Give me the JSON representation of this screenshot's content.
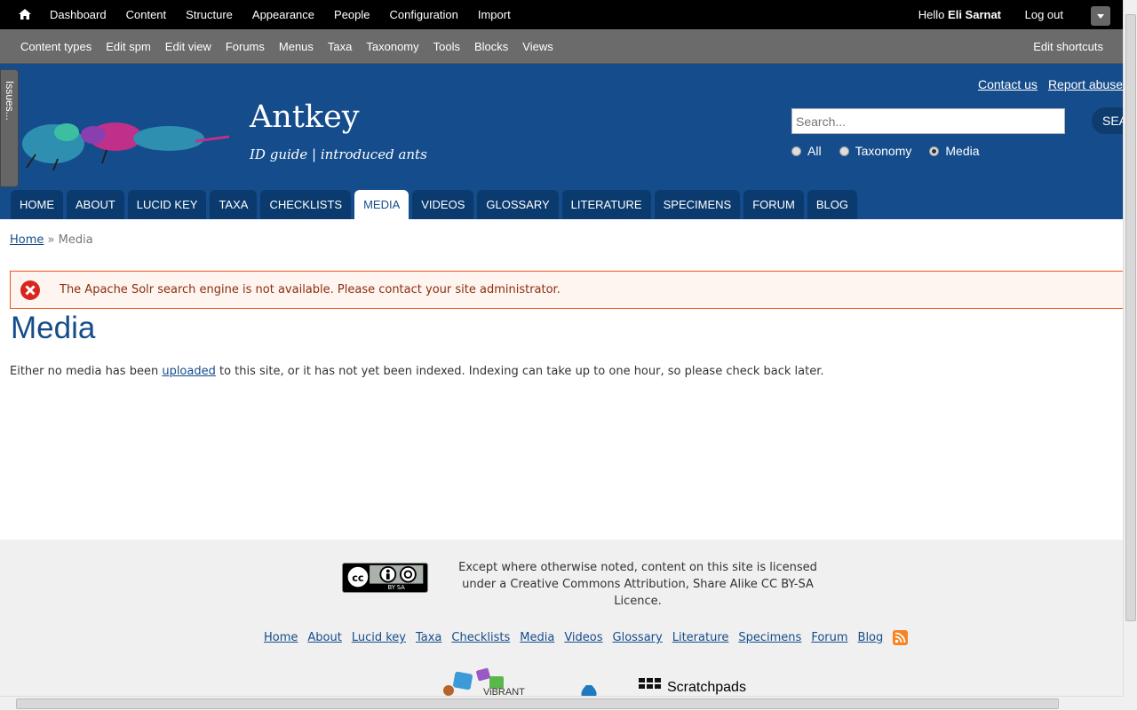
{
  "admin_bar": {
    "menu": [
      "Dashboard",
      "Content",
      "Structure",
      "Appearance",
      "People",
      "Configuration",
      "Import"
    ],
    "hello": "Hello ",
    "username": "Eli Sarnat",
    "logout": "Log out"
  },
  "shortcuts": {
    "items": [
      "Content types",
      "Edit spm",
      "Edit view",
      "Forums",
      "Menus",
      "Taxa",
      "Taxonomy",
      "Tools",
      "Blocks",
      "Views"
    ],
    "edit": "Edit shortcuts"
  },
  "issues_tab": "Issues...",
  "header": {
    "site_name": "Antkey",
    "slogan": "ID guide | introduced ants",
    "contact_us": "Contact us",
    "report_abuse": "Report abuse",
    "search_placeholder": "Search...",
    "search_button": "SEA",
    "search_options": [
      "All",
      "Taxonomy",
      "Media"
    ],
    "search_selected": "Media"
  },
  "tabs": [
    "HOME",
    "ABOUT",
    "LUCID KEY",
    "TAXA",
    "CHECKLISTS",
    "MEDIA",
    "VIDEOS",
    "GLOSSARY",
    "LITERATURE",
    "SPECIMENS",
    "FORUM",
    "BLOG"
  ],
  "active_tab": "MEDIA",
  "breadcrumb": {
    "home": "Home",
    "sep": " » ",
    "current": "Media"
  },
  "error": "The Apache Solr search engine is not available. Please contact your site administrator.",
  "page_title": "Media",
  "body": {
    "before": "Either no media has been ",
    "link": "uploaded",
    "after": " to this site, or it has not yet been indexed. Indexing can take up to one hour, so please check back later."
  },
  "footer": {
    "license": "Except where otherwise noted, content on this site is licensed under a Creative Commons Attribution, Share Alike CC BY-SA Licence.",
    "cc_label": "BY SA",
    "links": [
      "Home",
      "About",
      "Lucid key",
      "Taxa",
      "Checklists",
      "Media",
      "Videos",
      "Glossary",
      "Literature",
      "Specimens",
      "Forum",
      "Blog"
    ],
    "vibrant": "ViBRANT",
    "scratchpads": "Scratchpads"
  },
  "colors": {
    "header_bg": "#154c8b",
    "tab_bg": "#0b3b6e",
    "error_border": "#ed541d",
    "rss": "#f78422"
  }
}
